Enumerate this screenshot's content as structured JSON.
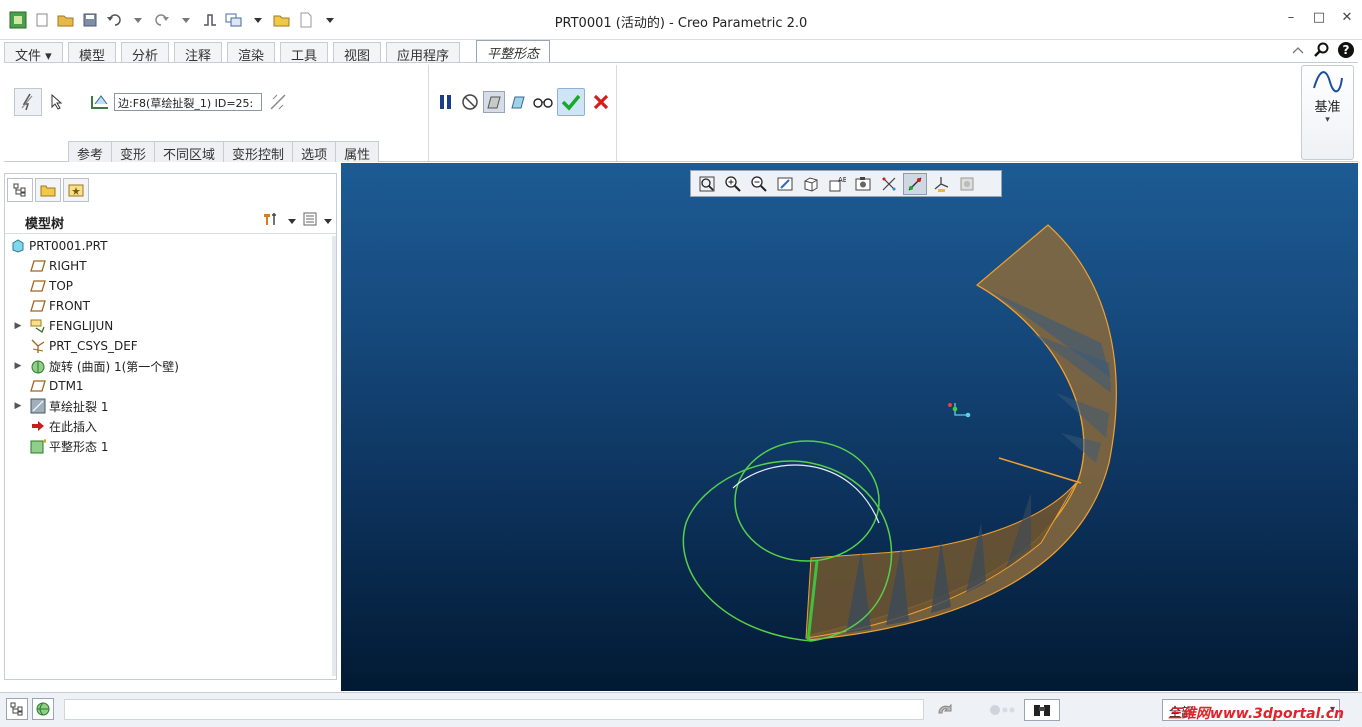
{
  "window": {
    "title": "PRT0001 (活动的) - Creo Parametric 2.0",
    "minimize_glyph": "–",
    "maximize_glyph": "□",
    "close_glyph": "✕"
  },
  "ribbon_tabs": [
    {
      "label": "文件 ▾"
    },
    {
      "label": "模型"
    },
    {
      "label": "分析"
    },
    {
      "label": "注释"
    },
    {
      "label": "渲染"
    },
    {
      "label": "工具"
    },
    {
      "label": "视图"
    },
    {
      "label": "应用程序"
    },
    {
      "label": "平整形态",
      "active": true
    }
  ],
  "ribbon": {
    "reference_value": "边:F8(草绘扯裂_1) ID=25:",
    "subtabs": [
      "参考",
      "变形",
      "不同区域",
      "变形控制",
      "选项",
      "属性"
    ],
    "datum_label": "基准",
    "datum_arrow": "▾"
  },
  "model_tree": {
    "title": "模型树",
    "items": [
      {
        "label": "PRT0001.PRT",
        "icon": "part-icon",
        "expandable": false,
        "indent": 0
      },
      {
        "label": "RIGHT",
        "icon": "datum-plane-icon",
        "expandable": false,
        "indent": 1
      },
      {
        "label": "TOP",
        "icon": "datum-plane-icon",
        "expandable": false,
        "indent": 1
      },
      {
        "label": "FRONT",
        "icon": "datum-plane-icon",
        "expandable": false,
        "indent": 1
      },
      {
        "label": "FENGLIJUN",
        "icon": "sketch-icon",
        "expandable": true,
        "indent": 1
      },
      {
        "label": "PRT_CSYS_DEF",
        "icon": "csys-icon",
        "expandable": false,
        "indent": 1
      },
      {
        "label": "旋转 (曲面) 1(第一个壁)",
        "icon": "revolve-icon",
        "expandable": true,
        "indent": 1
      },
      {
        "label": "DTM1",
        "icon": "datum-plane-icon",
        "expandable": false,
        "indent": 1
      },
      {
        "label": "草绘扯裂 1",
        "icon": "rip-icon",
        "expandable": true,
        "indent": 1
      },
      {
        "label": "在此插入",
        "icon": "insert-here-icon",
        "expandable": false,
        "indent": 1
      },
      {
        "label": "平整形态 1",
        "icon": "flatten-icon",
        "expandable": false,
        "indent": 1
      }
    ]
  },
  "statusbar": {
    "selection_filter": "全部",
    "selection_arrow": "▾",
    "watermark": "三维网www.3dportal.cn"
  },
  "colors": {
    "viewport_top": "#1d5b94",
    "viewport_bottom": "#021a33",
    "surface_fill": "#8a6a3c",
    "surface_edge": "#f0a030",
    "curve_green": "#55d04a",
    "accept_green": "#1aa82a",
    "cancel_red": "#d81b1b"
  }
}
